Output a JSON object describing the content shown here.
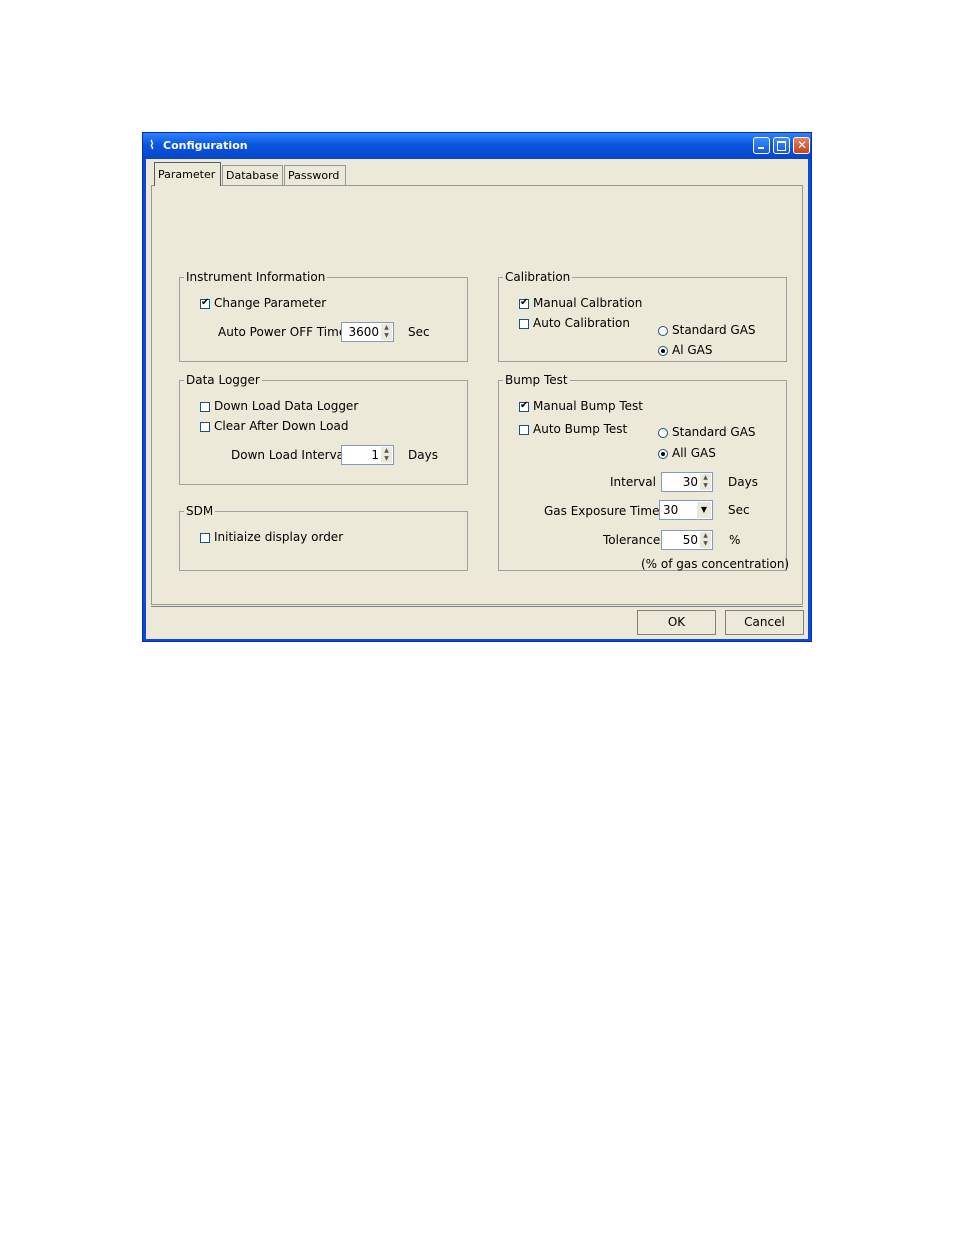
{
  "window": {
    "title": "Configuration",
    "icon": "app-icon"
  },
  "tabs": [
    "Parameter",
    "Database",
    "Password"
  ],
  "instrument": {
    "legend": "Instrument Information",
    "change_parameter": "Change Parameter",
    "change_parameter_checked": true,
    "auto_power_label": "Auto Power OFF Time",
    "auto_power_value": "3600",
    "auto_power_unit": "Sec"
  },
  "calibration": {
    "legend": "Calibration",
    "manual": "Manual Calbration",
    "manual_checked": true,
    "auto": "Auto Calibration",
    "auto_checked": false,
    "standard_gas": "Standard GAS",
    "all_gas": "Al GAS",
    "selected": "all_gas"
  },
  "data_logger": {
    "legend": "Data Logger",
    "download": "Down Load Data Logger",
    "download_checked": false,
    "clear": "Clear After Down Load",
    "clear_checked": false,
    "interval_label": "Down Load Interval",
    "interval_value": "1",
    "interval_unit": "Days"
  },
  "bump_test": {
    "legend": "Bump Test",
    "manual": "Manual Bump Test",
    "manual_checked": true,
    "auto": "Auto Bump Test",
    "auto_checked": false,
    "standard_gas": "Standard GAS",
    "all_gas": "All GAS",
    "selected": "all_gas",
    "interval_label": "Interval",
    "interval_value": "30",
    "interval_unit": "Days",
    "exposure_label": "Gas Exposure Time",
    "exposure_value": "30",
    "exposure_unit": "Sec",
    "tolerance_label": "Tolerance",
    "tolerance_value": "50",
    "tolerance_unit": "%",
    "note": "(% of gas concentration)"
  },
  "sdm": {
    "legend": "SDM",
    "init": "Initiaize display order",
    "init_checked": false
  },
  "buttons": {
    "ok": "OK",
    "cancel": "Cancel"
  },
  "colors": {
    "titlebar": "#0a56e0",
    "dialog_bg": "#ece9d8"
  }
}
